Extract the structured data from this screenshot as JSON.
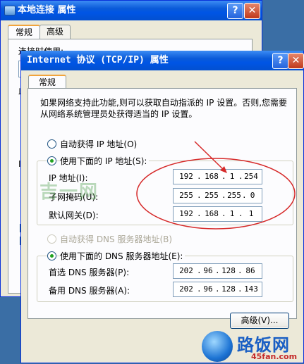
{
  "back_window": {
    "title": "本地连接 属性",
    "tabs": [
      "常规",
      "高级"
    ],
    "label": "连接时使用:",
    "frag1": "此",
    "frag2": "I"
  },
  "dialog": {
    "title": "Internet 协议 (TCP/IP) 属性",
    "tab": "常规",
    "description": "如果网络支持此功能,则可以获取自动指派的 IP 设置。否则,您需要从网络系统管理员处获得适当的 IP 设置。",
    "ip_auto_label": "自动获得 IP 地址(O)",
    "ip_manual_label": "使用下面的 IP 地址(S):",
    "ip_address_label": "IP 地址(I):",
    "subnet_label": "子网掩码(U):",
    "gateway_label": "默认网关(D):",
    "ip_address": [
      "192",
      "168",
      "1",
      "254"
    ],
    "subnet_mask": [
      "255",
      "255",
      "255",
      "0"
    ],
    "gateway": [
      "192",
      "168",
      "1",
      "1"
    ],
    "dns_auto_label": "自动获得 DNS 服务器地址(B)",
    "dns_manual_label": "使用下面的 DNS 服务器地址(E):",
    "dns_pref_label": "首选 DNS 服务器(P):",
    "dns_alt_label": "备用 DNS 服务器(A):",
    "dns_pref": [
      "202",
      "96",
      "128",
      "86"
    ],
    "dns_alt": [
      "202",
      "96",
      "128",
      "143"
    ],
    "advanced_button": "高级(V)...",
    "help_glyph": "?",
    "close_glyph": "✕"
  },
  "watermarks": {
    "left": "吉一网",
    "logo_big": "路饭网",
    "logo_small": "45fan.com"
  },
  "colors": {
    "titlebar": "#0a5ad8",
    "dialog_bg": "#ece9d8",
    "annotation_red": "#d62a2a"
  }
}
